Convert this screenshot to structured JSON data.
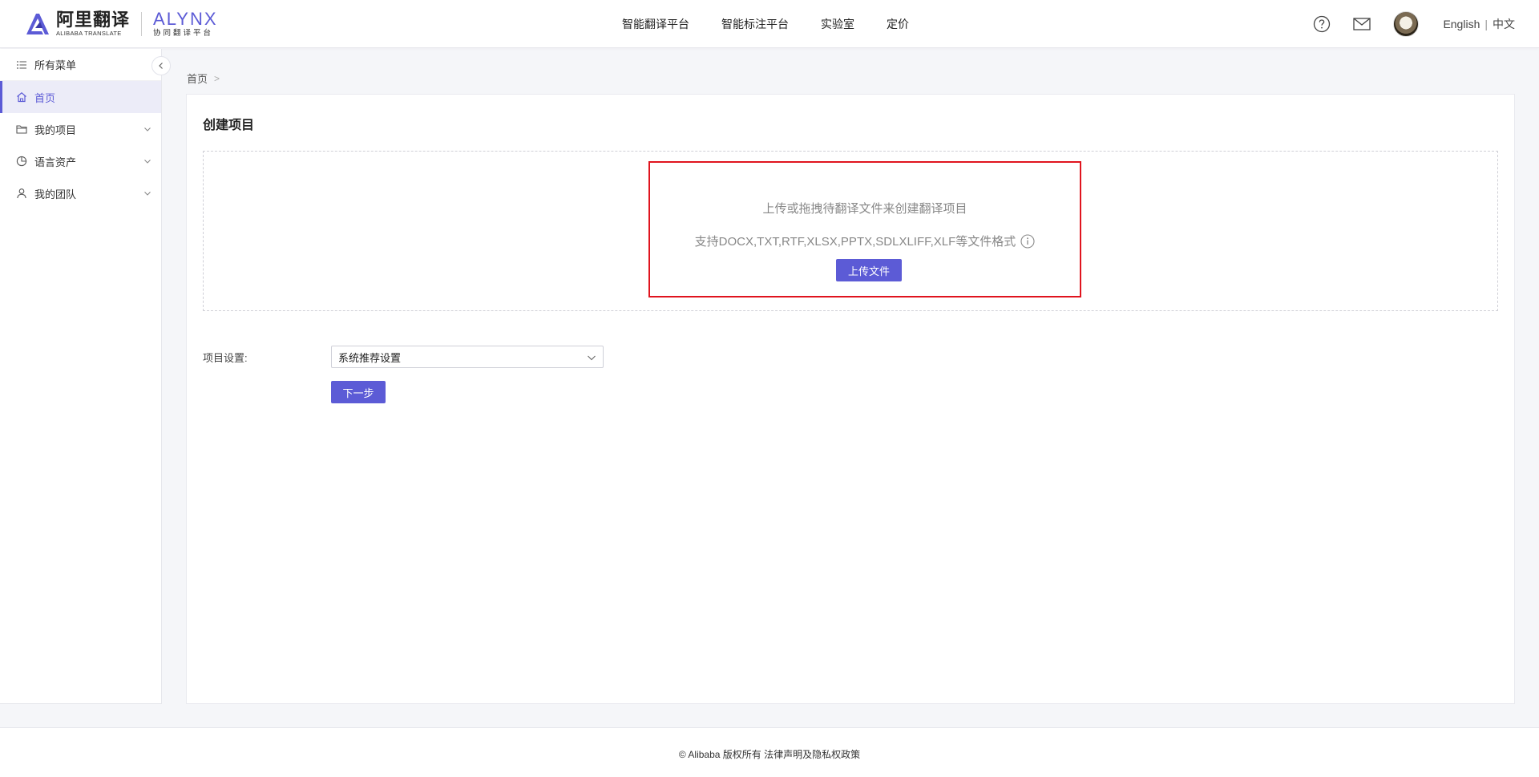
{
  "header": {
    "logo": {
      "cn_title": "阿里翻译",
      "cn_subtitle": "ALIBABA TRANSLATE",
      "en_title": "ALYNX",
      "en_subtitle": "协同翻译平台"
    },
    "nav": [
      {
        "label": "智能翻译平台"
      },
      {
        "label": "智能标注平台"
      },
      {
        "label": "实验室"
      },
      {
        "label": "定价"
      }
    ],
    "lang_en": "English",
    "lang_sep": "|",
    "lang_cn": "中文",
    "icons": [
      "help-icon",
      "mail-icon",
      "avatar"
    ]
  },
  "sidebar": {
    "all_menu": "所有菜单",
    "items": [
      {
        "label": "首页",
        "icon": "home-icon",
        "active": true
      },
      {
        "label": "我的项目",
        "icon": "folder-icon",
        "expandable": true
      },
      {
        "label": "语言资产",
        "icon": "pie-chart-icon",
        "expandable": true
      },
      {
        "label": "我的团队",
        "icon": "user-icon",
        "expandable": true
      }
    ]
  },
  "breadcrumb": {
    "home": "首页",
    "sep": ">"
  },
  "main": {
    "title": "创建项目",
    "dropzone": {
      "line1": "上传或拖拽待翻译文件来创建翻译项目",
      "line2": "支持DOCX,TXT,RTF,XLSX,PPTX,SDLXLIFF,XLF等文件格式",
      "upload_label": "上传文件"
    },
    "settings": {
      "label": "项目设置:",
      "selected": "系统推荐设置"
    },
    "next_label": "下一步"
  },
  "footer": {
    "text": "© Alibaba 版权所有 法律声明及隐私权政策"
  },
  "colors": {
    "accent": "#5c5bd6",
    "highlight": "#e0141e"
  }
}
